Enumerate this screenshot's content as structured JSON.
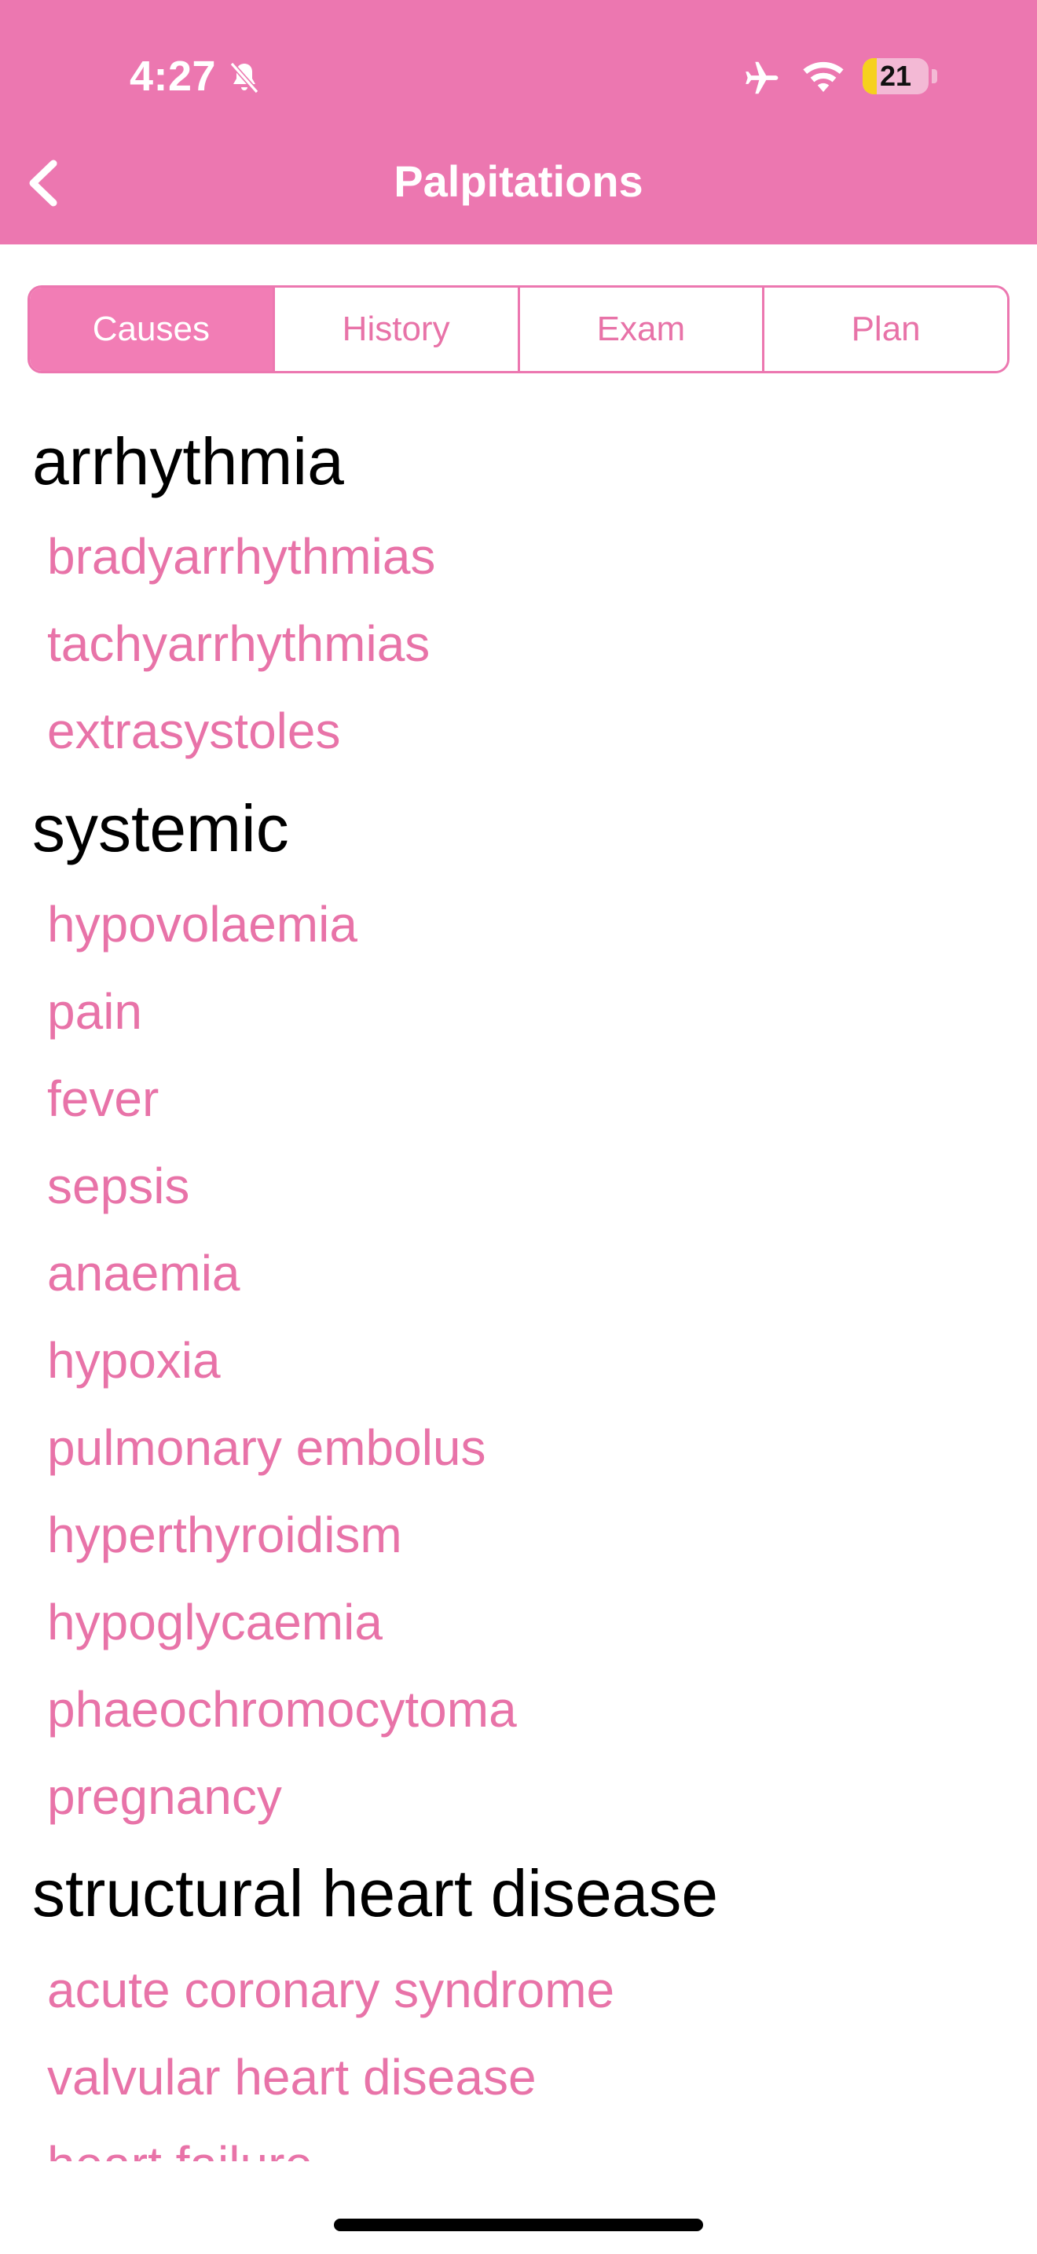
{
  "status_bar": {
    "time": "4:27",
    "battery": "21",
    "battery_level": 0.21,
    "icons": [
      "bell-slash-icon",
      "airplane-icon",
      "wifi-icon",
      "battery-icon"
    ]
  },
  "header": {
    "title": "Palpitations",
    "back_icon": "chevron-left-icon"
  },
  "tabs": [
    {
      "label": "Causes",
      "active": true
    },
    {
      "label": "History",
      "active": false
    },
    {
      "label": "Exam",
      "active": false
    },
    {
      "label": "Plan",
      "active": false
    }
  ],
  "groups": [
    {
      "title": "arrhythmia",
      "items": [
        "bradyarrhythmias",
        "tachyarrhythmias",
        "extrasystoles"
      ]
    },
    {
      "title": "systemic",
      "items": [
        "hypovolaemia",
        "pain",
        "fever",
        "sepsis",
        "anaemia",
        "hypoxia",
        "pulmonary embolus",
        "hyperthyroidism",
        "hypoglycaemia",
        "phaeochromocytoma",
        "pregnancy"
      ]
    },
    {
      "title": "structural heart disease",
      "items": [
        "acute coronary syndrome",
        "valvular heart disease",
        "heart failure"
      ]
    }
  ],
  "colors": {
    "accent": "#ec77b0",
    "link": "#e873a8",
    "text": "#000000"
  }
}
